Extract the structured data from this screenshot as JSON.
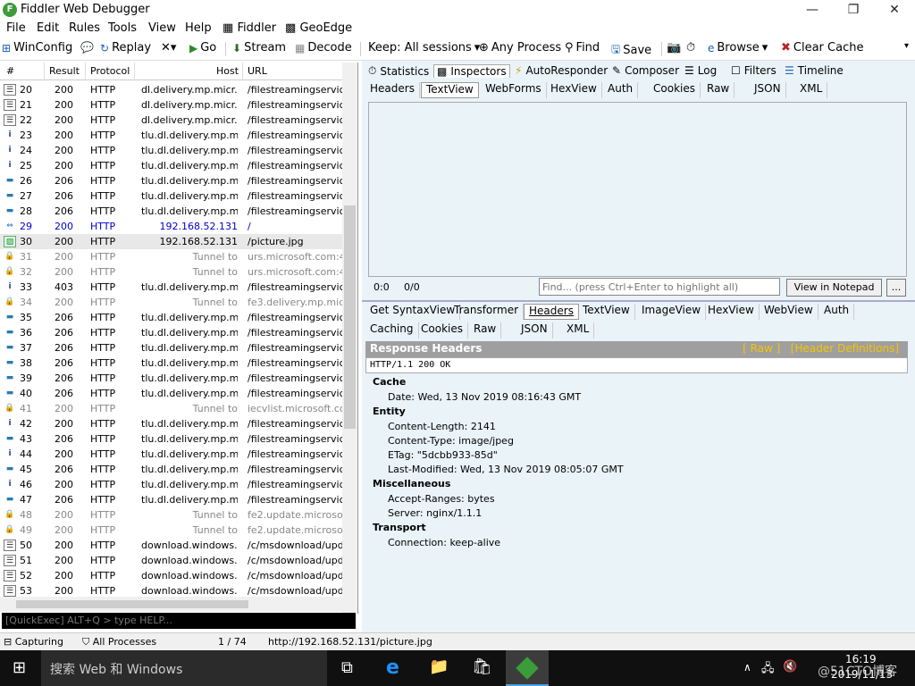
{
  "window": {
    "title": "Fiddler Web Debugger"
  },
  "menu": [
    "File",
    "Edit",
    "Rules",
    "Tools",
    "View",
    "Help",
    "Fiddler",
    "GeoEdge"
  ],
  "toolbar": {
    "winconfig": "WinConfig",
    "replay": "Replay",
    "go": "Go",
    "stream": "Stream",
    "decode": "Decode",
    "keep": "Keep: All sessions",
    "any_process": "Any Process",
    "find": "Find",
    "save": "Save",
    "browse": "Browse",
    "clear_cache": "Clear Cache"
  },
  "columns": {
    "num": "#",
    "result": "Result",
    "protocol": "Protocol",
    "host": "Host",
    "url": "URL"
  },
  "sessions": [
    {
      "num": "20",
      "result": "200",
      "protocol": "HTTP",
      "host": "dl.delivery.mp.micr...",
      "url": "/filestreamingservice/f",
      "icon": "doc",
      "style": ""
    },
    {
      "num": "21",
      "result": "200",
      "protocol": "HTTP",
      "host": "dl.delivery.mp.micr...",
      "url": "/filestreamingservice/f",
      "icon": "doc",
      "style": ""
    },
    {
      "num": "22",
      "result": "200",
      "protocol": "HTTP",
      "host": "dl.delivery.mp.micr...",
      "url": "/filestreamingservice/f",
      "icon": "doc",
      "style": ""
    },
    {
      "num": "23",
      "result": "200",
      "protocol": "HTTP",
      "host": "tlu.dl.delivery.mp.m...",
      "url": "/filestreamingservice/f",
      "icon": "info",
      "style": ""
    },
    {
      "num": "24",
      "result": "200",
      "protocol": "HTTP",
      "host": "tlu.dl.delivery.mp.m...",
      "url": "/filestreamingservice/f",
      "icon": "info",
      "style": ""
    },
    {
      "num": "25",
      "result": "200",
      "protocol": "HTTP",
      "host": "tlu.dl.delivery.mp.m...",
      "url": "/filestreamingservice/f",
      "icon": "info",
      "style": ""
    },
    {
      "num": "26",
      "result": "206",
      "protocol": "HTTP",
      "host": "tlu.dl.delivery.mp.m...",
      "url": "/filestreamingservice/f",
      "icon": "dash",
      "style": ""
    },
    {
      "num": "27",
      "result": "206",
      "protocol": "HTTP",
      "host": "tlu.dl.delivery.mp.m...",
      "url": "/filestreamingservice/f",
      "icon": "dash",
      "style": ""
    },
    {
      "num": "28",
      "result": "206",
      "protocol": "HTTP",
      "host": "tlu.dl.delivery.mp.m...",
      "url": "/filestreamingservice/f",
      "icon": "dash",
      "style": ""
    },
    {
      "num": "29",
      "result": "200",
      "protocol": "HTTP",
      "host": "192.168.52.131",
      "url": "/",
      "icon": "arrows",
      "style": "blue"
    },
    {
      "num": "30",
      "result": "200",
      "protocol": "HTTP",
      "host": "192.168.52.131",
      "url": "/picture.jpg",
      "icon": "img",
      "style": "sel"
    },
    {
      "num": "31",
      "result": "200",
      "protocol": "HTTP",
      "host": "Tunnel to",
      "url": "urs.microsoft.com:443",
      "icon": "lock",
      "style": "gray"
    },
    {
      "num": "32",
      "result": "200",
      "protocol": "HTTP",
      "host": "Tunnel to",
      "url": "urs.microsoft.com:443",
      "icon": "lock",
      "style": "gray"
    },
    {
      "num": "33",
      "result": "403",
      "protocol": "HTTP",
      "host": "tlu.dl.delivery.mp.m...",
      "url": "/filestreamingservice/f",
      "icon": "info",
      "style": ""
    },
    {
      "num": "34",
      "result": "200",
      "protocol": "HTTP",
      "host": "Tunnel to",
      "url": "fe3.delivery.mp.micro",
      "icon": "lock",
      "style": "gray"
    },
    {
      "num": "35",
      "result": "206",
      "protocol": "HTTP",
      "host": "tlu.dl.delivery.mp.m...",
      "url": "/filestreamingservice/f",
      "icon": "dash",
      "style": ""
    },
    {
      "num": "36",
      "result": "206",
      "protocol": "HTTP",
      "host": "tlu.dl.delivery.mp.m...",
      "url": "/filestreamingservice/f",
      "icon": "dash",
      "style": ""
    },
    {
      "num": "37",
      "result": "206",
      "protocol": "HTTP",
      "host": "tlu.dl.delivery.mp.m...",
      "url": "/filestreamingservice/f",
      "icon": "dash",
      "style": ""
    },
    {
      "num": "38",
      "result": "206",
      "protocol": "HTTP",
      "host": "tlu.dl.delivery.mp.m...",
      "url": "/filestreamingservice/f",
      "icon": "dash",
      "style": ""
    },
    {
      "num": "39",
      "result": "206",
      "protocol": "HTTP",
      "host": "tlu.dl.delivery.mp.m...",
      "url": "/filestreamingservice/f",
      "icon": "dash",
      "style": ""
    },
    {
      "num": "40",
      "result": "206",
      "protocol": "HTTP",
      "host": "tlu.dl.delivery.mp.m...",
      "url": "/filestreamingservice/f",
      "icon": "dash",
      "style": ""
    },
    {
      "num": "41",
      "result": "200",
      "protocol": "HTTP",
      "host": "Tunnel to",
      "url": "iecvlist.microsoft.com:",
      "icon": "lock",
      "style": "gray"
    },
    {
      "num": "42",
      "result": "200",
      "protocol": "HTTP",
      "host": "tlu.dl.delivery.mp.m...",
      "url": "/filestreamingservice/f",
      "icon": "info",
      "style": ""
    },
    {
      "num": "43",
      "result": "206",
      "protocol": "HTTP",
      "host": "tlu.dl.delivery.mp.m...",
      "url": "/filestreamingservice/f",
      "icon": "dash",
      "style": ""
    },
    {
      "num": "44",
      "result": "200",
      "protocol": "HTTP",
      "host": "tlu.dl.delivery.mp.m...",
      "url": "/filestreamingservice/f",
      "icon": "info",
      "style": ""
    },
    {
      "num": "45",
      "result": "206",
      "protocol": "HTTP",
      "host": "tlu.dl.delivery.mp.m...",
      "url": "/filestreamingservice/f",
      "icon": "dash",
      "style": ""
    },
    {
      "num": "46",
      "result": "200",
      "protocol": "HTTP",
      "host": "tlu.dl.delivery.mp.m...",
      "url": "/filestreamingservice/f",
      "icon": "info",
      "style": ""
    },
    {
      "num": "47",
      "result": "206",
      "protocol": "HTTP",
      "host": "tlu.dl.delivery.mp.m...",
      "url": "/filestreamingservice/f",
      "icon": "dash",
      "style": ""
    },
    {
      "num": "48",
      "result": "200",
      "protocol": "HTTP",
      "host": "Tunnel to",
      "url": "fe2.update.microsoft.",
      "icon": "lock",
      "style": "gray"
    },
    {
      "num": "49",
      "result": "200",
      "protocol": "HTTP",
      "host": "Tunnel to",
      "url": "fe2.update.microsoft.",
      "icon": "lock",
      "style": "gray"
    },
    {
      "num": "50",
      "result": "200",
      "protocol": "HTTP",
      "host": "download.windows....",
      "url": "/c/msdownload/updat",
      "icon": "doc",
      "style": ""
    },
    {
      "num": "51",
      "result": "200",
      "protocol": "HTTP",
      "host": "download.windows....",
      "url": "/c/msdownload/updat",
      "icon": "doc",
      "style": ""
    },
    {
      "num": "52",
      "result": "200",
      "protocol": "HTTP",
      "host": "download.windows....",
      "url": "/c/msdownload/updat",
      "icon": "doc",
      "style": ""
    },
    {
      "num": "53",
      "result": "200",
      "protocol": "HTTP",
      "host": "download.windows....",
      "url": "/c/msdownload/updat",
      "icon": "doc",
      "style": ""
    }
  ],
  "quickexec": "[QuickExec] ALT+Q > type HELP...",
  "main_tabs": [
    "Statistics",
    "Inspectors",
    "AutoResponder",
    "Composer",
    "Log",
    "Filters",
    "Timeline"
  ],
  "request_tabs": [
    "Headers",
    "TextView",
    "WebForms",
    "HexView",
    "Auth",
    "Cookies",
    "Raw",
    "JSON",
    "XML"
  ],
  "find": {
    "pos1": "0:0",
    "pos2": "0/0",
    "placeholder": "Find... (press Ctrl+Enter to highlight all)",
    "notepad": "View in Notepad",
    "more": "..."
  },
  "response_tabs_row1": [
    "Get SyntaxView",
    "Transformer",
    "Headers",
    "TextView",
    "ImageView",
    "HexView",
    "WebView",
    "Auth"
  ],
  "response_tabs_row2": [
    "Caching",
    "Cookies",
    "Raw",
    "JSON",
    "XML"
  ],
  "response": {
    "title": "Response Headers",
    "raw_link": "[ Raw ]",
    "defs_link": "[Header Definitions]",
    "status_line": "HTTP/1.1 200 OK",
    "groups": [
      {
        "name": "Cache",
        "items": [
          "Date: Wed, 13 Nov 2019 08:16:43 GMT"
        ]
      },
      {
        "name": "Entity",
        "items": [
          "Content-Length: 2141",
          "Content-Type: image/jpeg",
          "ETag: \"5dcbb933-85d\"",
          "Last-Modified: Wed, 13 Nov 2019 08:05:07 GMT"
        ]
      },
      {
        "name": "Miscellaneous",
        "items": [
          "Accept-Ranges: bytes",
          "Server: nginx/1.1.1"
        ]
      },
      {
        "name": "Transport",
        "items": [
          "Connection: keep-alive"
        ]
      }
    ]
  },
  "statusbar": {
    "capturing": "Capturing",
    "processes": "All Processes",
    "count": "1 / 74",
    "url": "http://192.168.52.131/picture.jpg"
  },
  "taskbar": {
    "search": "搜索 Web 和 Windows",
    "time": "16:19",
    "date": "2019/11/13",
    "watermark": "@51CTO博客"
  }
}
